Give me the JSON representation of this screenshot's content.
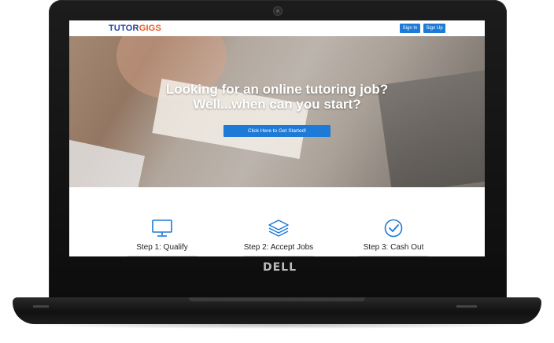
{
  "device": {
    "brand": "DELL"
  },
  "header": {
    "logo_part1": "TUTOR",
    "logo_part2": "GIGS",
    "sign_in_label": "Sign In",
    "sign_up_label": "Sign Up"
  },
  "hero": {
    "title_line1": "Looking for an online tutoring job?",
    "title_line2": "Well...when can you start?",
    "cta_label": "Click Here to Get Started!"
  },
  "steps": [
    {
      "label": "Step 1: Qualify",
      "icon": "monitor-icon"
    },
    {
      "label": "Step 2: Accept Jobs",
      "icon": "layers-icon"
    },
    {
      "label": "Step 3: Cash Out",
      "icon": "check-circle-icon"
    }
  ],
  "colors": {
    "accent": "#1d7ad7",
    "logo_primary": "#1f3f9e",
    "logo_secondary": "#f05a1e"
  }
}
